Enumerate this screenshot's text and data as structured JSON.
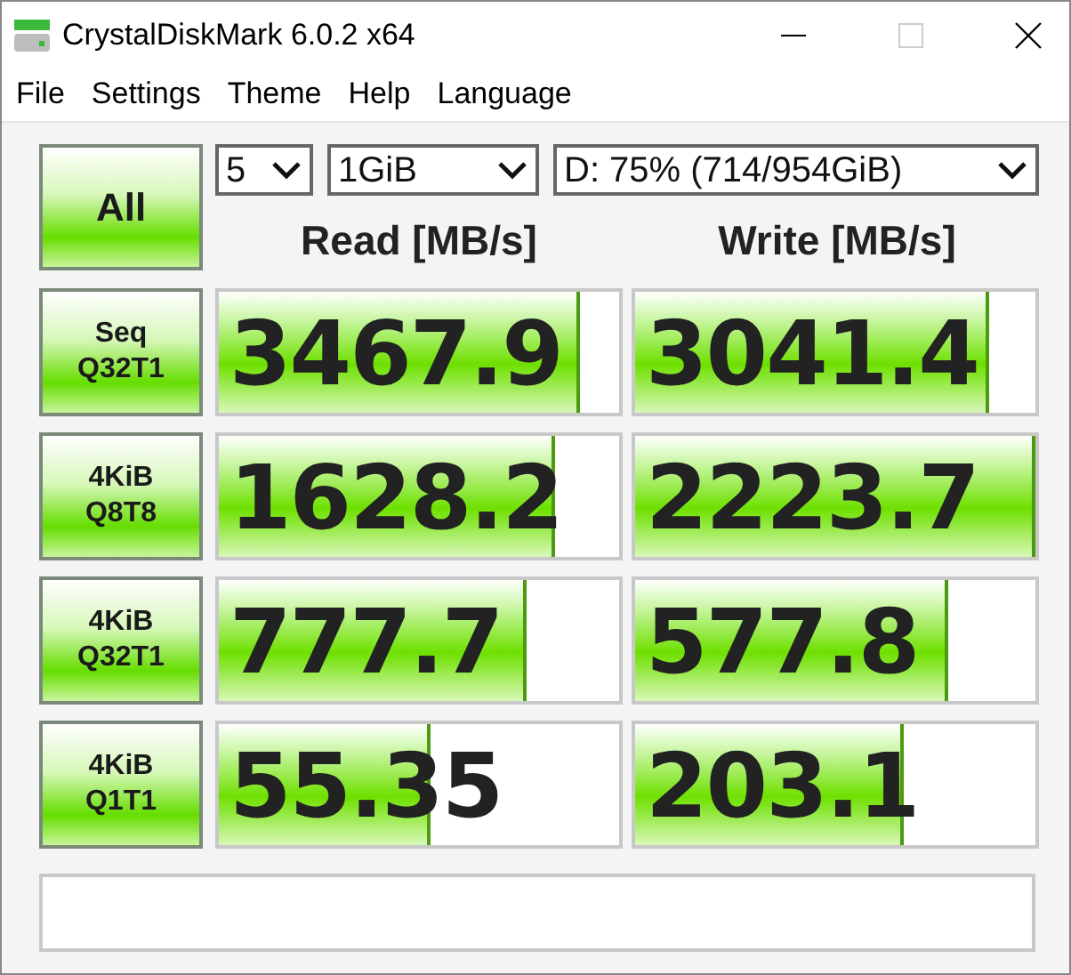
{
  "window": {
    "title": "CrystalDiskMark 6.0.2 x64"
  },
  "menu": [
    "File",
    "Settings",
    "Theme",
    "Help",
    "Language"
  ],
  "all_button": "All",
  "selectors": [
    {
      "value": "5"
    },
    {
      "value": "1GiB"
    },
    {
      "value": "D: 75% (714/954GiB)"
    }
  ],
  "columns": [
    "Read [MB/s]",
    "Write [MB/s]"
  ],
  "rows": [
    {
      "label": [
        "Seq",
        "Q32T1"
      ],
      "read": {
        "value": "3467.9",
        "level": 0.9
      },
      "write": {
        "value": "3041.4",
        "level": 0.885
      }
    },
    {
      "label": [
        "4KiB",
        "Q8T8"
      ],
      "read": {
        "value": "1628.2",
        "level": 0.84
      },
      "write": {
        "value": "2223.7",
        "level": 1
      }
    },
    {
      "label": [
        "4KiB",
        "Q32T1"
      ],
      "read": {
        "value": "777.7",
        "level": 0.77
      },
      "write": {
        "value": "577.8",
        "level": 0.78
      }
    },
    {
      "label": [
        "4KiB",
        "Q1T1"
      ],
      "read": {
        "value": "55.35",
        "level": 0.53
      },
      "write": {
        "value": "203.1",
        "level": 0.67
      }
    }
  ]
}
